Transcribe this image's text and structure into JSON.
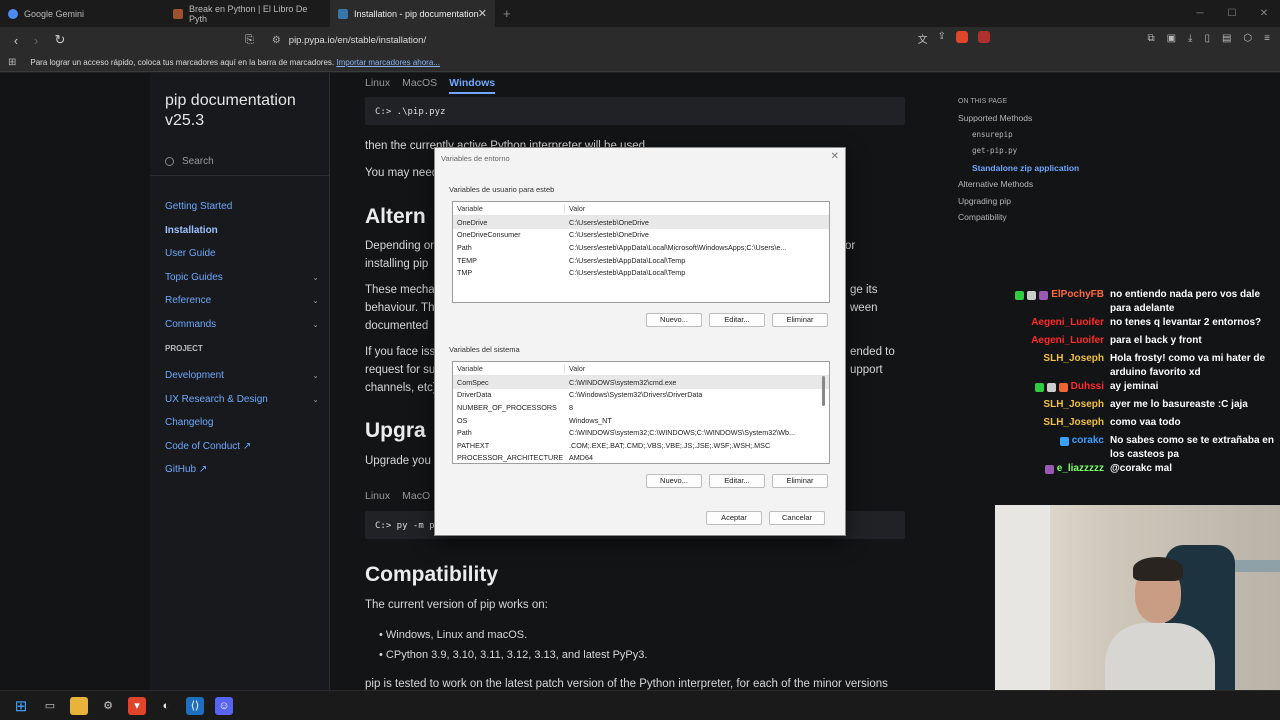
{
  "browser": {
    "tabs": [
      {
        "label": "Google Gemini",
        "color": "#4c8bf5",
        "active": false
      },
      {
        "label": "Break en Python | El Libro De Pyth",
        "color": "#a05030",
        "active": false
      },
      {
        "label": "Installation - pip documentation",
        "color": "#3776ab",
        "active": true
      }
    ],
    "new_tab": "+",
    "url": "pip.pypa.io/en/stable/installation/",
    "bookmarks_text": "Para lograr un acceso rápido, coloca tus marcadores aquí en la barra de marcadores.",
    "bookmarks_link": "Importar marcadores ahora..."
  },
  "sidebar": {
    "title_line1": "pip documentation",
    "title_line2": "v25.3",
    "search_placeholder": "Search",
    "nav": [
      {
        "label": "Getting Started",
        "expandable": false
      },
      {
        "label": "Installation",
        "expandable": false,
        "current": true
      },
      {
        "label": "User Guide",
        "expandable": false
      },
      {
        "label": "Topic Guides",
        "expandable": true
      },
      {
        "label": "Reference",
        "expandable": true
      },
      {
        "label": "Commands",
        "expandable": true
      }
    ],
    "project_label": "PROJECT",
    "project_nav": [
      {
        "label": "Development",
        "expandable": true
      },
      {
        "label": "UX Research & Design",
        "expandable": true
      },
      {
        "label": "Changelog",
        "expandable": false
      },
      {
        "label": "Code of Conduct ↗",
        "expandable": false
      },
      {
        "label": "GitHub ↗",
        "expandable": false
      }
    ]
  },
  "content": {
    "os_tabs": [
      "Linux",
      "MacOS",
      "Windows"
    ],
    "code1": "C:> .\\pip.pyz",
    "para1": "then the currently active Python interpreter will be used.",
    "para2": "You may need",
    "h_alternative": "Altern",
    "para3_a": "Depending on",
    "para3_b": "installing pip",
    "para3_r": "or",
    "para4_a": "These mechan",
    "para4_b": "behaviour. Th",
    "para4_c": "documented",
    "para4_r1": "ge its",
    "para4_r2": "ween",
    "para5_a": "If you face iss",
    "para5_b": "request for su",
    "para5_c": "channels, etc)",
    "para5_r1": "ended to",
    "para5_r2": "upport",
    "h_upgrading": "Upgra",
    "para6": "Upgrade you",
    "os_tabs2": [
      "Linux",
      "MacO"
    ],
    "code2": "C:> py -m p",
    "h_compat": "Compatibility",
    "compat_intro": "The current version of pip works on:",
    "compat_items": [
      "Windows, Linux and macOS.",
      "CPython 3.9, 3.10, 3.11, 3.12, 3.13, and latest PyPy3."
    ],
    "compat_last": "pip is tested to work on the latest patch version of the Python interpreter, for each of the minor versions"
  },
  "toc": {
    "header": "ON THIS PAGE",
    "items": [
      {
        "label": "Supported Methods",
        "kind": "item"
      },
      {
        "label": "ensurepip",
        "kind": "sub"
      },
      {
        "label": "get-pip.py",
        "kind": "sub"
      },
      {
        "label": "Standalone zip application",
        "kind": "active"
      },
      {
        "label": "Alternative Methods",
        "kind": "item"
      },
      {
        "label": "Upgrading pip",
        "kind": "item"
      },
      {
        "label": "Compatibility",
        "kind": "item"
      }
    ]
  },
  "dialog": {
    "title": "Variables de entorno",
    "user_group": "Variables de usuario para esteb",
    "col_variable": "Variable",
    "col_value": "Valor",
    "user_vars": [
      [
        "OneDrive",
        "C:\\Users\\esteb\\OneDrive"
      ],
      [
        "OneDriveConsumer",
        "C:\\Users\\esteb\\OneDrive"
      ],
      [
        "Path",
        "C:\\Users\\esteb\\AppData\\Local\\Microsoft\\WindowsApps;C:\\Users\\e..."
      ],
      [
        "TEMP",
        "C:\\Users\\esteb\\AppData\\Local\\Temp"
      ],
      [
        "TMP",
        "C:\\Users\\esteb\\AppData\\Local\\Temp"
      ]
    ],
    "system_group": "Variables del sistema",
    "system_vars": [
      [
        "ComSpec",
        "C:\\WINDOWS\\system32\\cmd.exe"
      ],
      [
        "DriverData",
        "C:\\Windows\\System32\\Drivers\\DriverData"
      ],
      [
        "NUMBER_OF_PROCESSORS",
        "8"
      ],
      [
        "OS",
        "Windows_NT"
      ],
      [
        "Path",
        "C:\\WINDOWS\\system32;C:\\WINDOWS;C:\\WINDOWS\\System32\\Wb..."
      ],
      [
        "PATHEXT",
        ".COM;.EXE;.BAT;.CMD;.VBS;.VBE;.JS;.JSE;.WSF;.WSH;.MSC"
      ],
      [
        "PROCESSOR_ARCHITECTURE",
        "AMD64"
      ]
    ],
    "btn_new": "Nuevo...",
    "btn_edit": "Editar...",
    "btn_delete": "Eliminar",
    "btn_accept": "Aceptar",
    "btn_cancel": "Cancelar"
  },
  "chat": [
    {
      "user": "ElPochyFB",
      "color": "#ff6a3d",
      "badges": [
        "#2ecc40",
        "#ccc",
        "#9b59b6"
      ],
      "msg": "no entiendo nada pero vos dale para adelante"
    },
    {
      "user": "Aegeni_Luoifer",
      "color": "#ff2a2a",
      "badges": [],
      "msg": "no tenes q levantar 2 entornos?"
    },
    {
      "user": "Aegeni_Luoifer",
      "color": "#ff2a2a",
      "badges": [],
      "msg": "para el back y front"
    },
    {
      "user": "SLH_Joseph",
      "color": "#f0c040",
      "badges": [],
      "msg": "Hola frosty! como va mi hater de arduino favorito xd"
    },
    {
      "user": "Duhssi",
      "color": "#ff2a2a",
      "badges": [
        "#2ecc40",
        "#ccc",
        "#e63"
      ],
      "msg": "ay jeminai"
    },
    {
      "user": "SLH_Joseph",
      "color": "#f0c040",
      "badges": [],
      "msg": "ayer me lo basureaste :C jaja"
    },
    {
      "user": "SLH_Joseph",
      "color": "#f0c040",
      "badges": [],
      "msg": "como vaa todo"
    },
    {
      "user": "corakc",
      "color": "#3aa0ff",
      "badges": [
        "#3aa0ff"
      ],
      "msg": "No sabes como se te extrañaba en los casteos pa"
    },
    {
      "user": "e_liazzzzz",
      "color": "#7dff6a",
      "badges": [
        "#9b59b6"
      ],
      "msg": "@corakc mal"
    }
  ]
}
